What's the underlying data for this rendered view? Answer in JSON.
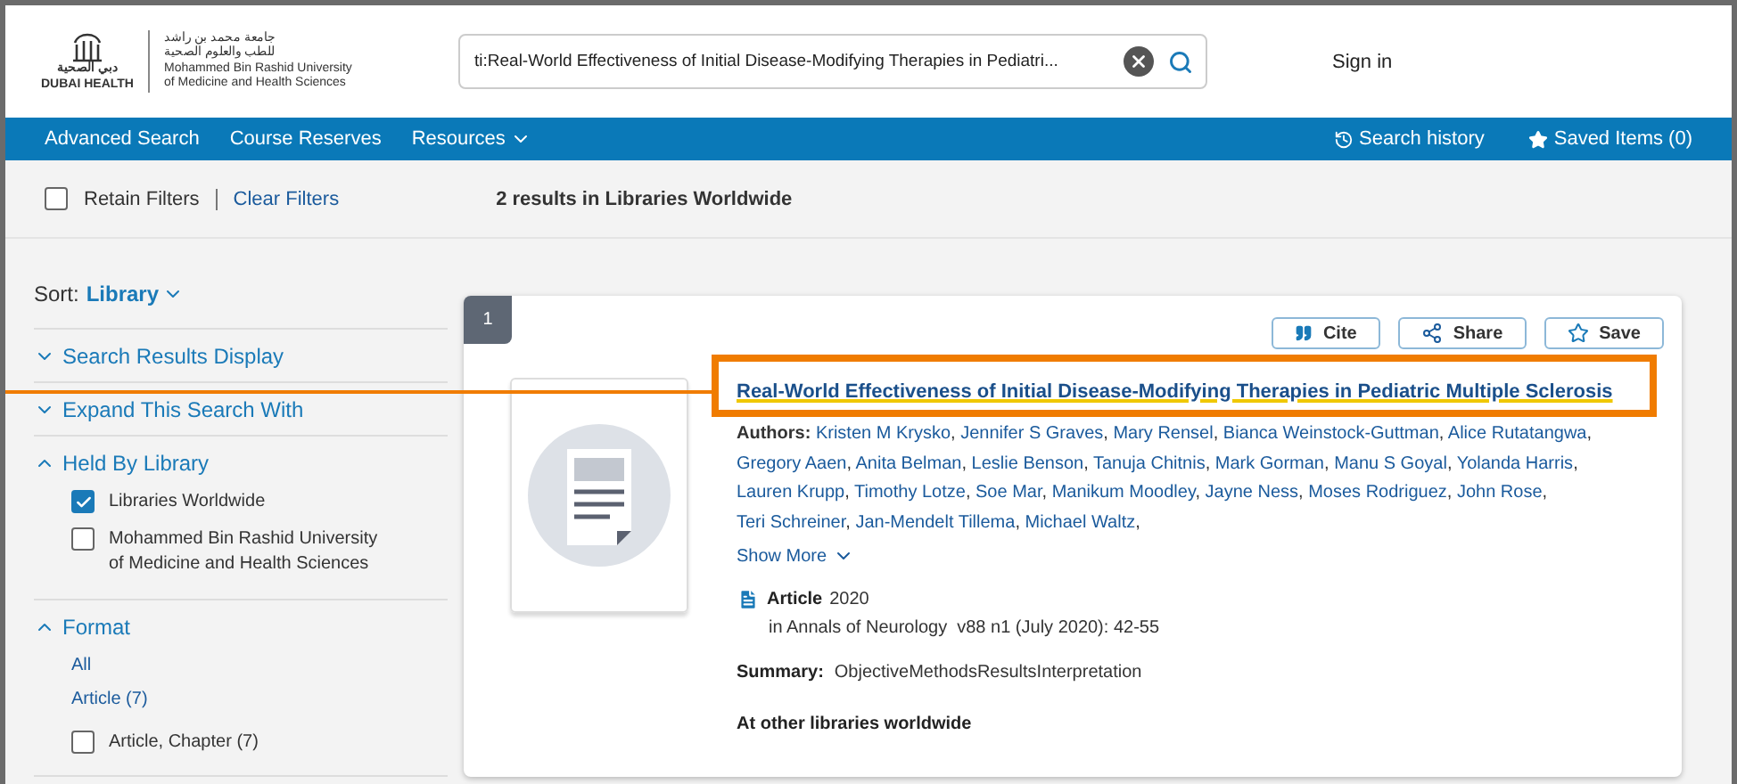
{
  "header": {
    "logo": {
      "dubai_arabic": "دبي الصحية",
      "dubai_latin": "DUBAI HEALTH",
      "arabic_lines": [
        "جامعة محمد بن راشد",
        "للطب والعلوم الصحية"
      ],
      "latin_lines": [
        "Mohammed Bin Rashid University",
        "of Medicine and Health Sciences"
      ]
    },
    "search": {
      "value": "ti:Real-World Effectiveness of Initial Disease-Modifying Therapies in Pediatri..."
    },
    "sign_in": "Sign in"
  },
  "nav": {
    "items": [
      {
        "label": "Advanced Search",
        "dropdown": false
      },
      {
        "label": "Course Reserves",
        "dropdown": false
      },
      {
        "label": "Resources",
        "dropdown": true
      }
    ],
    "right": [
      {
        "kind": "history",
        "label": "Search history"
      },
      {
        "kind": "saved",
        "label": "Saved Items (0)"
      }
    ]
  },
  "filter_bar": {
    "retain_filters": {
      "label": "Retain Filters",
      "checked": false
    },
    "clear_filters": "Clear Filters",
    "results_count": "2 results in Libraries Worldwide"
  },
  "sidebar": {
    "sort": {
      "label": "Sort:",
      "value": "Library"
    },
    "sections": [
      {
        "title": "Search Results Display",
        "expanded": false
      },
      {
        "title": "Expand This Search With",
        "expanded": false
      },
      {
        "title": "Held By Library",
        "expanded": true,
        "options": [
          {
            "label": "Libraries Worldwide",
            "checked": true
          },
          {
            "label": "Mohammed Bin Rashid University of Medicine and Health Sciences",
            "checked": false
          }
        ]
      },
      {
        "title": "Format",
        "expanded": true,
        "links": [
          "All",
          "Article (7)"
        ],
        "options": [
          {
            "label": "Article, Chapter (7)",
            "checked": false
          }
        ]
      }
    ]
  },
  "results": [
    {
      "number": "1",
      "actions": [
        {
          "kind": "cite",
          "label": "Cite"
        },
        {
          "kind": "share",
          "label": "Share"
        },
        {
          "kind": "save",
          "label": "Save"
        }
      ],
      "title": "Real-World Effectiveness of Initial Disease-Modifying Therapies in Pediatric Multiple Sclerosis",
      "authors_label": "Authors:",
      "author_separator": ",",
      "authors": [
        "Kristen M Krysko",
        "Jennifer S Graves",
        "Mary Rensel",
        "Bianca Weinstock-Guttman",
        "Alice Rutatangwa",
        "Gregory Aaen",
        "Anita Belman",
        "Leslie Benson",
        "Tanuja Chitnis",
        "Mark Gorman",
        "Manu S Goyal",
        "Yolanda Harris",
        "Lauren Krupp",
        "Timothy Lotze",
        "Soe Mar",
        "Manikum Moodley",
        "Jayne Ness",
        "Moses Rodriguez",
        "John Rose",
        "Teri Schreiner",
        "Jan-Mendelt Tillema",
        "Michael Waltz"
      ],
      "show_more": "Show More",
      "format": "Article",
      "year": "2020",
      "source": "in Annals of Neurology  v88 n1 (July 2020): 42-55",
      "summary_label": "Summary:",
      "summary": "ObjectiveMethodsResultsInterpretation",
      "availability": "At other libraries worldwide"
    }
  ]
}
